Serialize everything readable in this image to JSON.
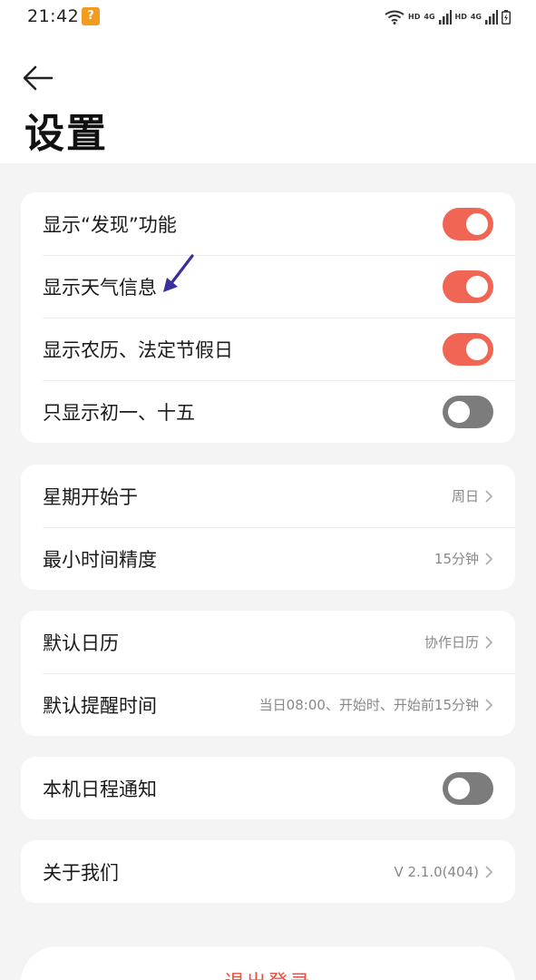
{
  "status_bar": {
    "time": "21:42",
    "notification_badge": "?",
    "network_tag_1": "HD",
    "network_gen_1": "4G",
    "network_tag_2": "HD",
    "network_gen_2": "4G"
  },
  "header": {
    "title": "设置"
  },
  "display_group": {
    "items": [
      {
        "label": "显示“发现”功能",
        "enabled": true
      },
      {
        "label": "显示天气信息",
        "enabled": true
      },
      {
        "label": "显示农历、法定节假日",
        "enabled": true
      },
      {
        "label": "只显示初一、十五",
        "enabled": false
      }
    ]
  },
  "time_group": {
    "items": [
      {
        "label": "星期开始于",
        "value": "周日"
      },
      {
        "label": "最小时间精度",
        "value": "15分钟"
      }
    ]
  },
  "calendar_group": {
    "items": [
      {
        "label": "默认日历",
        "value": "协作日历"
      },
      {
        "label": "默认提醒时间",
        "value": "当日08:00、开始时、开始前15分钟"
      }
    ]
  },
  "notification_group": {
    "label": "本机日程通知",
    "enabled": false
  },
  "about_group": {
    "label": "关于我们",
    "value": "V 2.1.0(404)"
  },
  "logout_label": "退出登录",
  "colors": {
    "toggle_on": "#f06553",
    "toggle_off": "#7c7c7c",
    "logout_text": "#e8503f",
    "annotation_arrow": "#3b2f9e",
    "notification_badge": "#f39a1f"
  }
}
